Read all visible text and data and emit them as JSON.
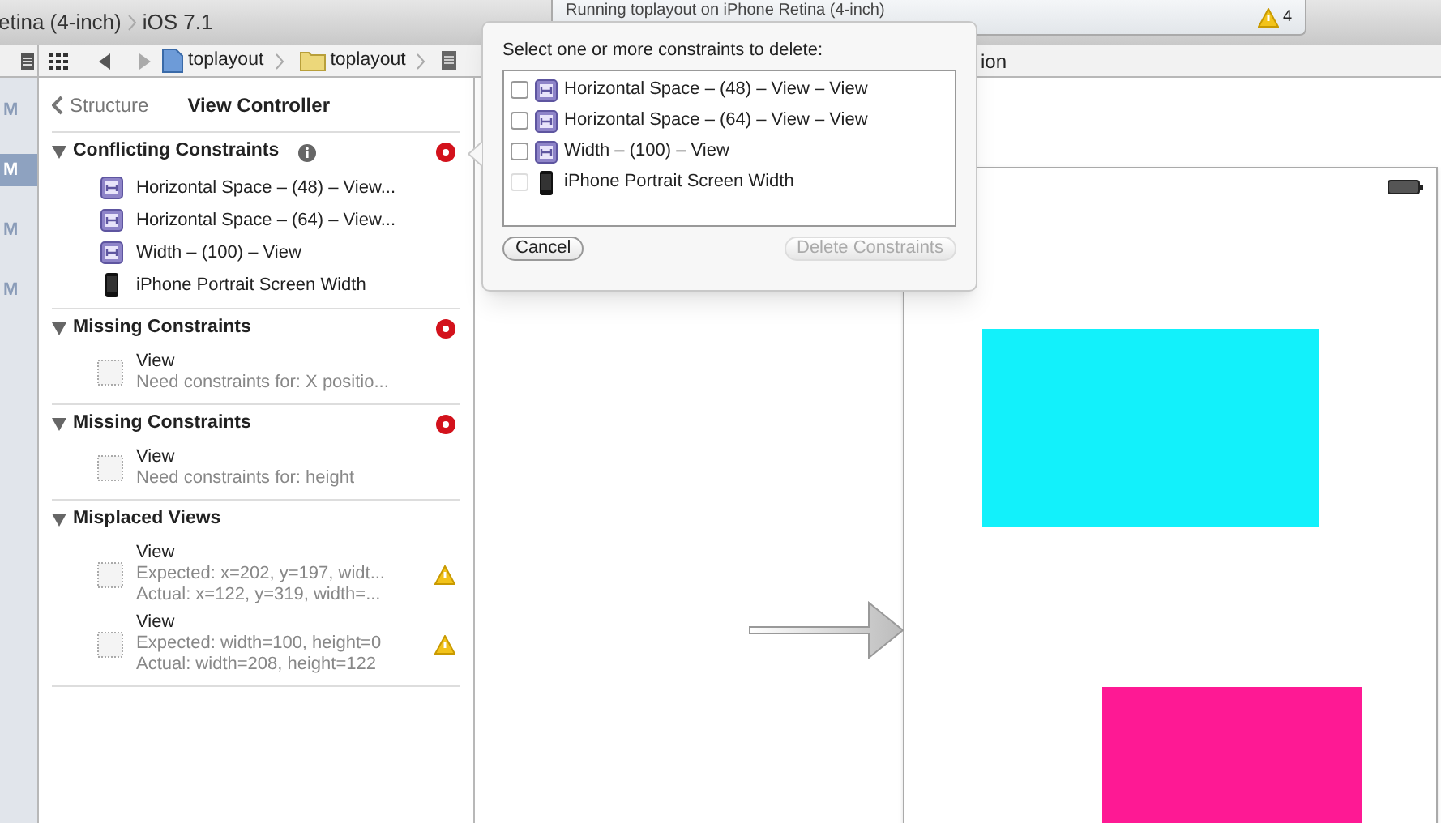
{
  "toolbar": {
    "scheme_tail": "etina (4-inch)",
    "sdk": "iOS 7.1",
    "activity": "Running toplayout on iPhone Retina (4-inch)",
    "warning_count": "4"
  },
  "jump_bar": {
    "items": [
      {
        "kind": "project",
        "label": "toplayout"
      },
      {
        "kind": "folder",
        "label": "toplayout"
      }
    ],
    "tail": "ion"
  },
  "navigator_strip": [
    {
      "label": "M",
      "selected": false
    },
    {
      "label": "M",
      "selected": true
    },
    {
      "label": "M",
      "selected": false
    },
    {
      "label": "M",
      "selected": false
    }
  ],
  "issue_navigator": {
    "back": "Structure",
    "title": "View Controller",
    "groups": [
      {
        "title": "Conflicting Constraints",
        "info": true,
        "error": true,
        "items": [
          {
            "kind": "constraint",
            "warning": false,
            "lines": [
              "Horizontal Space – (48) – View..."
            ]
          },
          {
            "kind": "constraint",
            "warning": false,
            "lines": [
              "Horizontal Space – (64) – View..."
            ]
          },
          {
            "kind": "constraint",
            "warning": false,
            "lines": [
              "Width – (100) – View"
            ]
          },
          {
            "kind": "device",
            "warning": false,
            "lines": [
              "iPhone Portrait Screen Width"
            ]
          }
        ]
      },
      {
        "title": "Missing Constraints",
        "info": false,
        "error": true,
        "items": [
          {
            "kind": "view",
            "warning": false,
            "lines": [
              "View",
              "Need constraints for: X positio..."
            ]
          }
        ]
      },
      {
        "title": "Missing Constraints",
        "info": false,
        "error": true,
        "items": [
          {
            "kind": "view",
            "warning": false,
            "lines": [
              "View",
              "Need constraints for: height"
            ]
          }
        ]
      },
      {
        "title": "Misplaced Views",
        "info": false,
        "error": false,
        "items": [
          {
            "kind": "view",
            "warning": true,
            "lines": [
              "View",
              "Expected: x=202, y=197, widt...",
              "Actual: x=122, y=319, width=..."
            ]
          },
          {
            "kind": "view",
            "warning": true,
            "lines": [
              "View",
              "Expected: width=100, height=0",
              "Actual: width=208, height=122"
            ]
          }
        ]
      }
    ]
  },
  "popover": {
    "prompt": "Select one or more constraints to delete:",
    "options": [
      {
        "kind": "constraint",
        "label": "Horizontal Space – (48) – View – View",
        "checked": false,
        "disabled": false
      },
      {
        "kind": "constraint",
        "label": "Horizontal Space – (64) – View – View",
        "checked": false,
        "disabled": false
      },
      {
        "kind": "constraint",
        "label": "Width – (100) – View",
        "checked": false,
        "disabled": false
      },
      {
        "kind": "device",
        "label": "iPhone Portrait Screen Width",
        "checked": false,
        "disabled": true
      }
    ],
    "buttons": [
      {
        "label": "Cancel",
        "disabled": false
      },
      {
        "label": "Delete Constraints",
        "disabled": true
      }
    ]
  },
  "canvas": {
    "views": [
      {
        "color": "#12f1fb"
      },
      {
        "color": "#fe1994"
      }
    ]
  }
}
